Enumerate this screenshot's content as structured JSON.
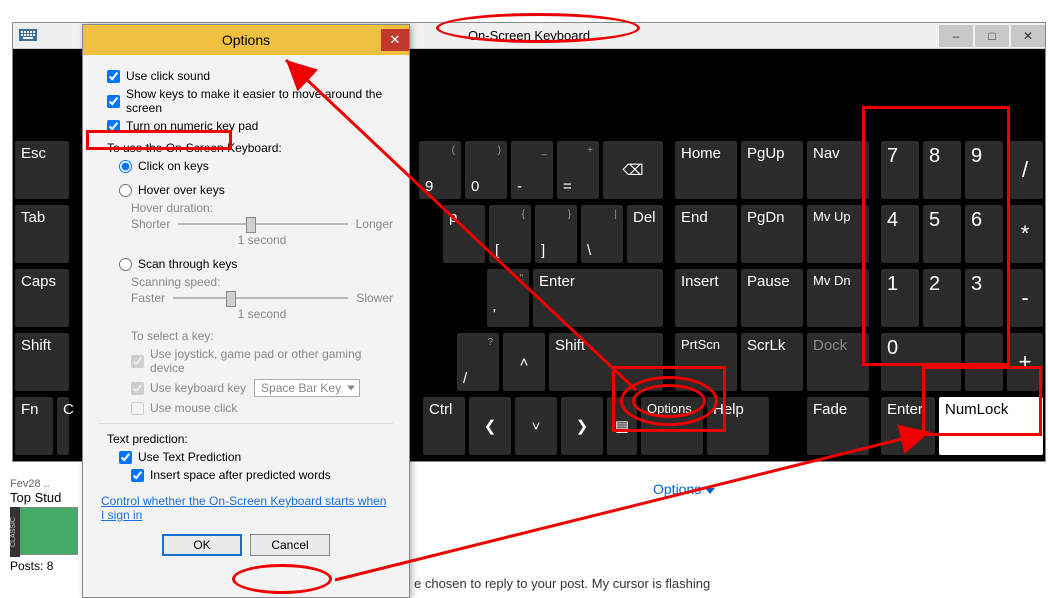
{
  "osk": {
    "title": "On-Screen Keyboard",
    "min_tip": "–",
    "max_tip": "□",
    "close_tip": "✕",
    "options_toggle": "Options",
    "keys": {
      "esc": "Esc",
      "tab": "Tab",
      "caps": "Caps",
      "shift_l": "Shift",
      "shift_r": "Shift",
      "fn": "Fn",
      "ctrl": "Ctrl",
      "enter": "Enter",
      "del": "Del",
      "end": "End",
      "home": "Home",
      "insert": "Insert",
      "pause": "Pause",
      "prtscn": "PrtScn",
      "scrlk": "ScrLk",
      "pgup": "PgUp",
      "pgdn": "PgDn",
      "nav": "Nav",
      "mvup": "Mv Up",
      "mvdn": "Mv Dn",
      "dock": "Dock",
      "fade": "Fade",
      "options": "Options",
      "help": "Help",
      "numlock": "NumLock",
      "num0": "0",
      "num1": "1",
      "num2": "2",
      "num3": "3",
      "num4": "4",
      "num5": "5",
      "num6": "6",
      "num7": "7",
      "num8": "8",
      "num9": "9",
      "numdot": ".",
      "numslash": "/",
      "nummul": "*",
      "numminus": "-",
      "numplus": "+",
      "enter_pad": "Enter",
      "k9": "9",
      "k0": "0",
      "kminus": "-",
      "kequal": "=",
      "kp": "p",
      "klb": "[",
      "krb": "]",
      "kbs": "\\",
      "kquote": "'",
      "k_slash": "/",
      "k_q": "?",
      "backspace": "⌫",
      "left": "❮",
      "right": "❯",
      "up": "˄",
      "down": "˅",
      "menu": "▤",
      "top9_sub": "(",
      "top0_sub": ")",
      "topminus_sub": "_",
      "topeq_sub": "+",
      "lb_sub": "{",
      "rb_sub": "}",
      "bs_sub": "|",
      "quote_sub": "\""
    }
  },
  "dlg": {
    "title": "Options",
    "close": "✕",
    "use_click_sound": "Use click sound",
    "show_keys": "Show keys to make it easier to move around the screen",
    "numeric_keypad": "Turn on numeric key pad",
    "to_use": "To use the On-Screen Keyboard:",
    "click_on_keys": "Click on keys",
    "hover_over_keys": "Hover over keys",
    "hover_duration": "Hover duration:",
    "shorter": "Shorter",
    "longer": "Longer",
    "one_second": "1 second",
    "scan_through_keys": "Scan through keys",
    "scanning_speed": "Scanning speed:",
    "faster": "Faster",
    "slower": "Slower",
    "to_select": "To select a key:",
    "use_joystick": "Use joystick, game pad or other gaming device",
    "use_kbd_key": "Use keyboard key",
    "spacebar_key": "Space Bar Key",
    "use_mouse_click": "Use mouse click",
    "text_prediction": "Text prediction:",
    "use_text_prediction": "Use Text Prediction",
    "insert_space": "Insert space after predicted words",
    "startup_link": "Control whether the On-Screen Keyboard starts when I sign in",
    "ok": "OK",
    "cancel": "Cancel"
  },
  "page": {
    "date": "Fev28 ..",
    "user": "Top Stud",
    "side_txt": "CLASSIC",
    "posts_label": "Posts:",
    "posts_count": "8",
    "reply": "e chosen to reply to your post. My cursor is flashing"
  }
}
